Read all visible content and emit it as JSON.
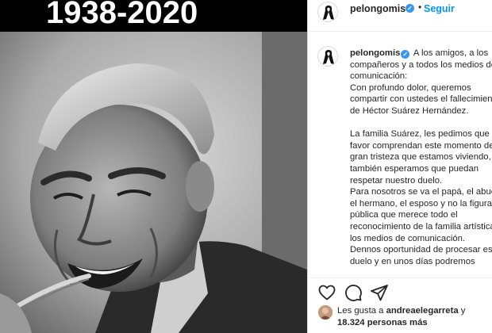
{
  "photo": {
    "banner_text": "1938-2020"
  },
  "post": {
    "username": "pelongomis",
    "verified_symbol": "✓",
    "separator": "•",
    "follow_label": "Seguir"
  },
  "caption": {
    "username": "pelongomis",
    "lines": [
      "A los amigos, a los",
      "compañeros y a todos los medios de",
      "comunicación:",
      "Con profundo dolor, queremos",
      "compartir con ustedes el fallecimiento",
      "de Héctor Suárez Hernández.",
      "",
      "La familia Suárez, les pedimos que por",
      "favor comprendan este momento de",
      "gran tristeza que estamos viviendo,",
      "también esperamos que puedan",
      "respetar nuestro duelo.",
      "Para nosotros se va el papá, el abuelo,",
      "el hermano, el esposo y no la figura",
      "pública que merece todo el",
      "reconocimiento de la familia artística y",
      "los medios de comunicación.",
      "Dennos oportunidad de procesar este",
      "duelo y en unos días podremos"
    ]
  },
  "actions": {
    "like_icon": "heart-icon",
    "comment_icon": "comment-icon",
    "share_icon": "share-icon",
    "save_icon": "bookmark-icon"
  },
  "likes": {
    "prefix": "Les gusta a ",
    "user": "andreaelegarreta",
    "connector": " y",
    "count": "18.324 personas más"
  },
  "colors": {
    "accent": "#0095f6",
    "verified": "#3897f0",
    "text": "#262626"
  }
}
